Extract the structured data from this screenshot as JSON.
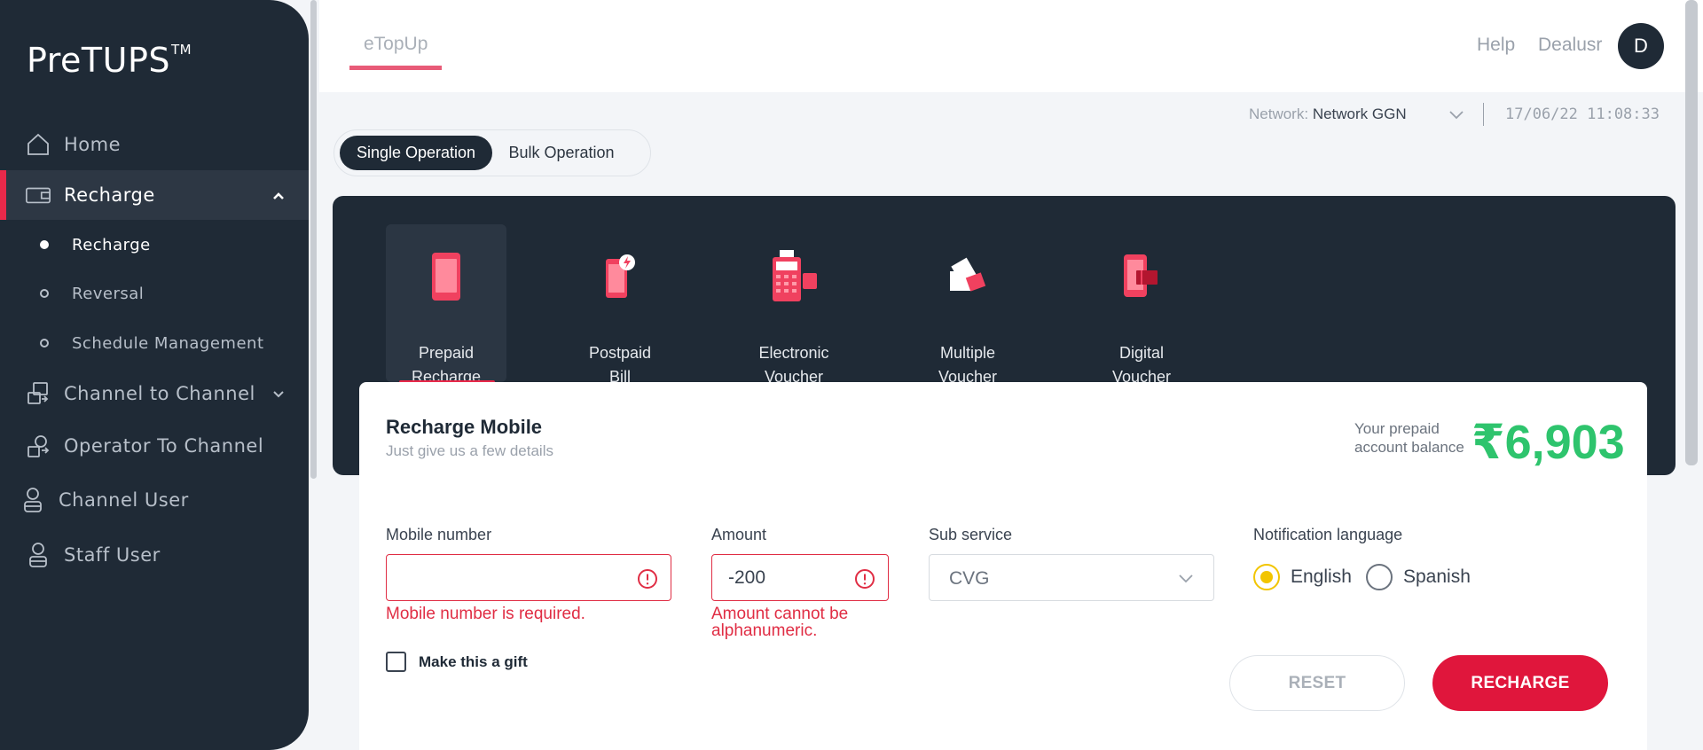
{
  "brand": {
    "name": "PreTUPS",
    "tm": "TM"
  },
  "sidebar": {
    "items": [
      {
        "label": "Home",
        "icon": "home-icon"
      },
      {
        "label": "Recharge",
        "icon": "wallet-icon",
        "expanded": true
      },
      {
        "label": "Channel to Channel",
        "icon": "transfer-icon"
      },
      {
        "label": "Operator To Channel",
        "icon": "operator-icon"
      },
      {
        "label": "Channel User",
        "icon": "user-icon"
      },
      {
        "label": "Staff User",
        "icon": "user-icon"
      }
    ],
    "recharge_sub": [
      {
        "label": "Recharge",
        "active": true
      },
      {
        "label": "Reversal"
      },
      {
        "label": "Schedule Management"
      }
    ]
  },
  "header": {
    "app_tab": "eTopUp",
    "help": "Help",
    "username": "Dealusr",
    "avatar_initial": "D",
    "network_label": "Network:",
    "network_value": "Network GGN",
    "datetime": "17/06/22 11:08:33"
  },
  "operation_tabs": {
    "single": "Single Operation",
    "bulk": "Bulk Operation",
    "selected": "single"
  },
  "services": [
    {
      "line1": "Prepaid",
      "line2": "Recharge",
      "icon": "mobile-icon",
      "active": true
    },
    {
      "line1": "Postpaid",
      "line2": "Bill",
      "icon": "mobile-bill-icon"
    },
    {
      "line1": "Electronic",
      "line2": "Voucher",
      "icon": "pos-terminal-icon"
    },
    {
      "line1": "Multiple",
      "line2": "Voucher",
      "icon": "vouchers-icon"
    },
    {
      "line1": "Digital",
      "line2": "Voucher",
      "icon": "digital-voucher-icon"
    }
  ],
  "form": {
    "title": "Recharge Mobile",
    "subtitle": "Just give us a few details",
    "balance_label": "Your prepaid account balance",
    "balance_value": "₹6,903",
    "mobile_label": "Mobile number",
    "mobile_value": "",
    "mobile_error": "Mobile number is required.",
    "amount_label": "Amount",
    "amount_value": "-200",
    "amount_error_line1": "Amount cannot be",
    "amount_error_line2": "alphanumeric.",
    "subservice_label": "Sub service",
    "subservice_value": "CVG",
    "notification_label": "Notification language",
    "lang_english": "English",
    "lang_spanish": "Spanish",
    "selected_language": "English",
    "gift_label": "Make this a gift",
    "gift_checked": false,
    "reset_label": "RESET",
    "recharge_label": "RECHARGE"
  },
  "colors": {
    "accent": "#e0163c",
    "sidebar": "#1f2a36",
    "balance": "#2ec46d",
    "error": "#e02d44",
    "radio_on": "#f2c500"
  }
}
